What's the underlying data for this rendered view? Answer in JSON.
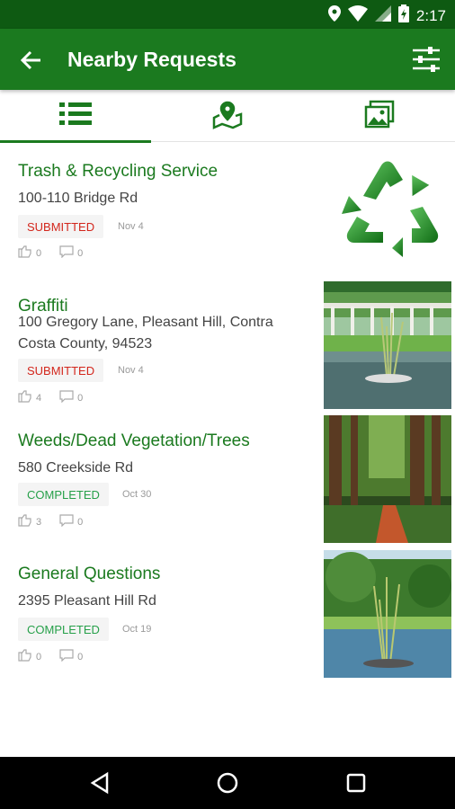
{
  "status_bar": {
    "time": "2:17"
  },
  "app_bar": {
    "title": "Nearby Requests"
  },
  "tabs": [
    {
      "name": "list",
      "icon": "list-icon",
      "active": true
    },
    {
      "name": "map",
      "icon": "map-pin-icon",
      "active": false
    },
    {
      "name": "gallery",
      "icon": "gallery-icon",
      "active": false
    }
  ],
  "requests": [
    {
      "title": "Trash & Recycling Service",
      "address": "100-110  Bridge Rd",
      "status": "SUBMITTED",
      "date": "Nov 4",
      "votes": "0",
      "comments": "0",
      "image": "recycle-symbol"
    },
    {
      "title": "Graffiti",
      "address": "100  Gregory Lane, Pleasant Hill, Contra Costa County, 94523",
      "status": "SUBMITTED",
      "date": "Nov 4",
      "votes": "4",
      "comments": "0",
      "image": "pond-pergola-photo"
    },
    {
      "title": "Weeds/Dead Vegetation/Trees",
      "address": "580  Creekside Rd",
      "status": "COMPLETED",
      "date": "Oct 30",
      "votes": "3",
      "comments": "0",
      "image": "forest-path-photo"
    },
    {
      "title": "General Questions",
      "address": "2395  Pleasant Hill Rd",
      "status": "COMPLETED",
      "date": "Oct 19",
      "votes": "0",
      "comments": "0",
      "image": "pond-reeds-photo"
    }
  ],
  "colors": {
    "primary": "#1b7a1f",
    "status_bar": "#0e5a12",
    "submitted": "#d3261c",
    "completed": "#27a04a"
  }
}
